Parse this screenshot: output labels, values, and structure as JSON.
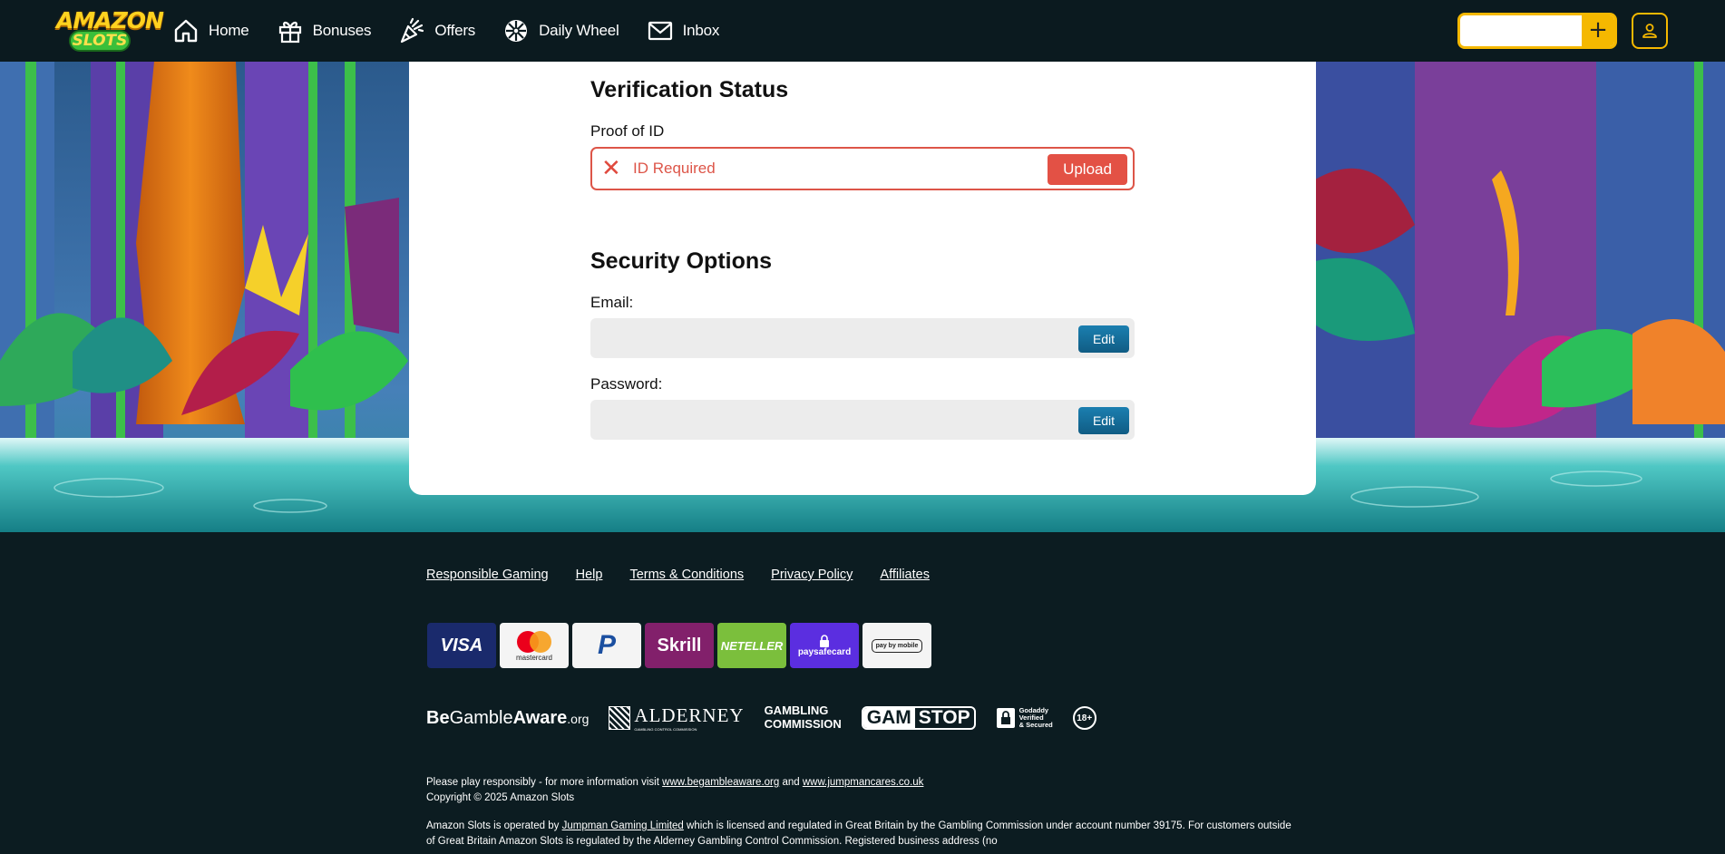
{
  "brand": {
    "logo_top": "AMAZON",
    "logo_bottom": "SLOTS"
  },
  "nav": [
    {
      "label": "Home",
      "icon": "home-icon"
    },
    {
      "label": "Bonuses",
      "icon": "gift-icon"
    },
    {
      "label": "Offers",
      "icon": "party-popper-icon"
    },
    {
      "label": "Daily Wheel",
      "icon": "wheel-icon"
    },
    {
      "label": "Inbox",
      "icon": "mail-icon"
    }
  ],
  "header": {
    "deposit_symbol": "+",
    "balance_value": ""
  },
  "verification": {
    "title": "Verification Status",
    "proof_label": "Proof of ID",
    "status_icon": "✕",
    "status_text": "ID Required",
    "upload_label": "Upload"
  },
  "security": {
    "title": "Security Options",
    "email_label": "Email:",
    "email_value": "",
    "password_label": "Password:",
    "password_value": "",
    "edit_label": "Edit"
  },
  "footer": {
    "links": [
      "Responsible Gaming",
      "Help",
      "Terms & Conditions",
      "Privacy Policy",
      "Affiliates"
    ],
    "payments": [
      "VISA",
      "mastercard",
      "P",
      "Skrill",
      "NETELLER",
      "paysafecard",
      "pay by mobile"
    ],
    "regulators": {
      "begambleaware_be": "Be",
      "begambleaware_gamble": "Gamble",
      "begambleaware_aware": "Aware",
      "begambleaware_org": ".org",
      "alderney": "ALDERNEY",
      "alderney_sub": "GAMBLING CONTROL COMMISSION",
      "gc_line1": "GAMBLING",
      "gc_line2": "COMMISSION",
      "gamstop_a": "GAM",
      "gamstop_b": "STOP",
      "godaddy_1": "Godaddy",
      "godaddy_2": "Verified",
      "godaddy_3": "& Secured",
      "age": "18+"
    },
    "disclaimer_1a": "Please play responsibly - for more information visit ",
    "disclaimer_link1": "www.begambleaware.org",
    "disclaimer_1b": " and ",
    "disclaimer_link2": "www.jumpmancares.co.uk",
    "copyright": "Copyright © 2025 Amazon Slots",
    "operated_a": "Amazon Slots is operated by ",
    "operated_link": "Jumpman Gaming Limited",
    "operated_b": " which is licensed and regulated in Great Britain by the Gambling Commission under account number 39175. For customers outside of Great Britain Amazon Slots is regulated by the Alderney Gambling Control Commission. Registered business address (no"
  },
  "colors": {
    "accent": "#f5b800",
    "error": "#e35145",
    "edit": "#1477a8",
    "footer_bg": "#0c1c21"
  }
}
